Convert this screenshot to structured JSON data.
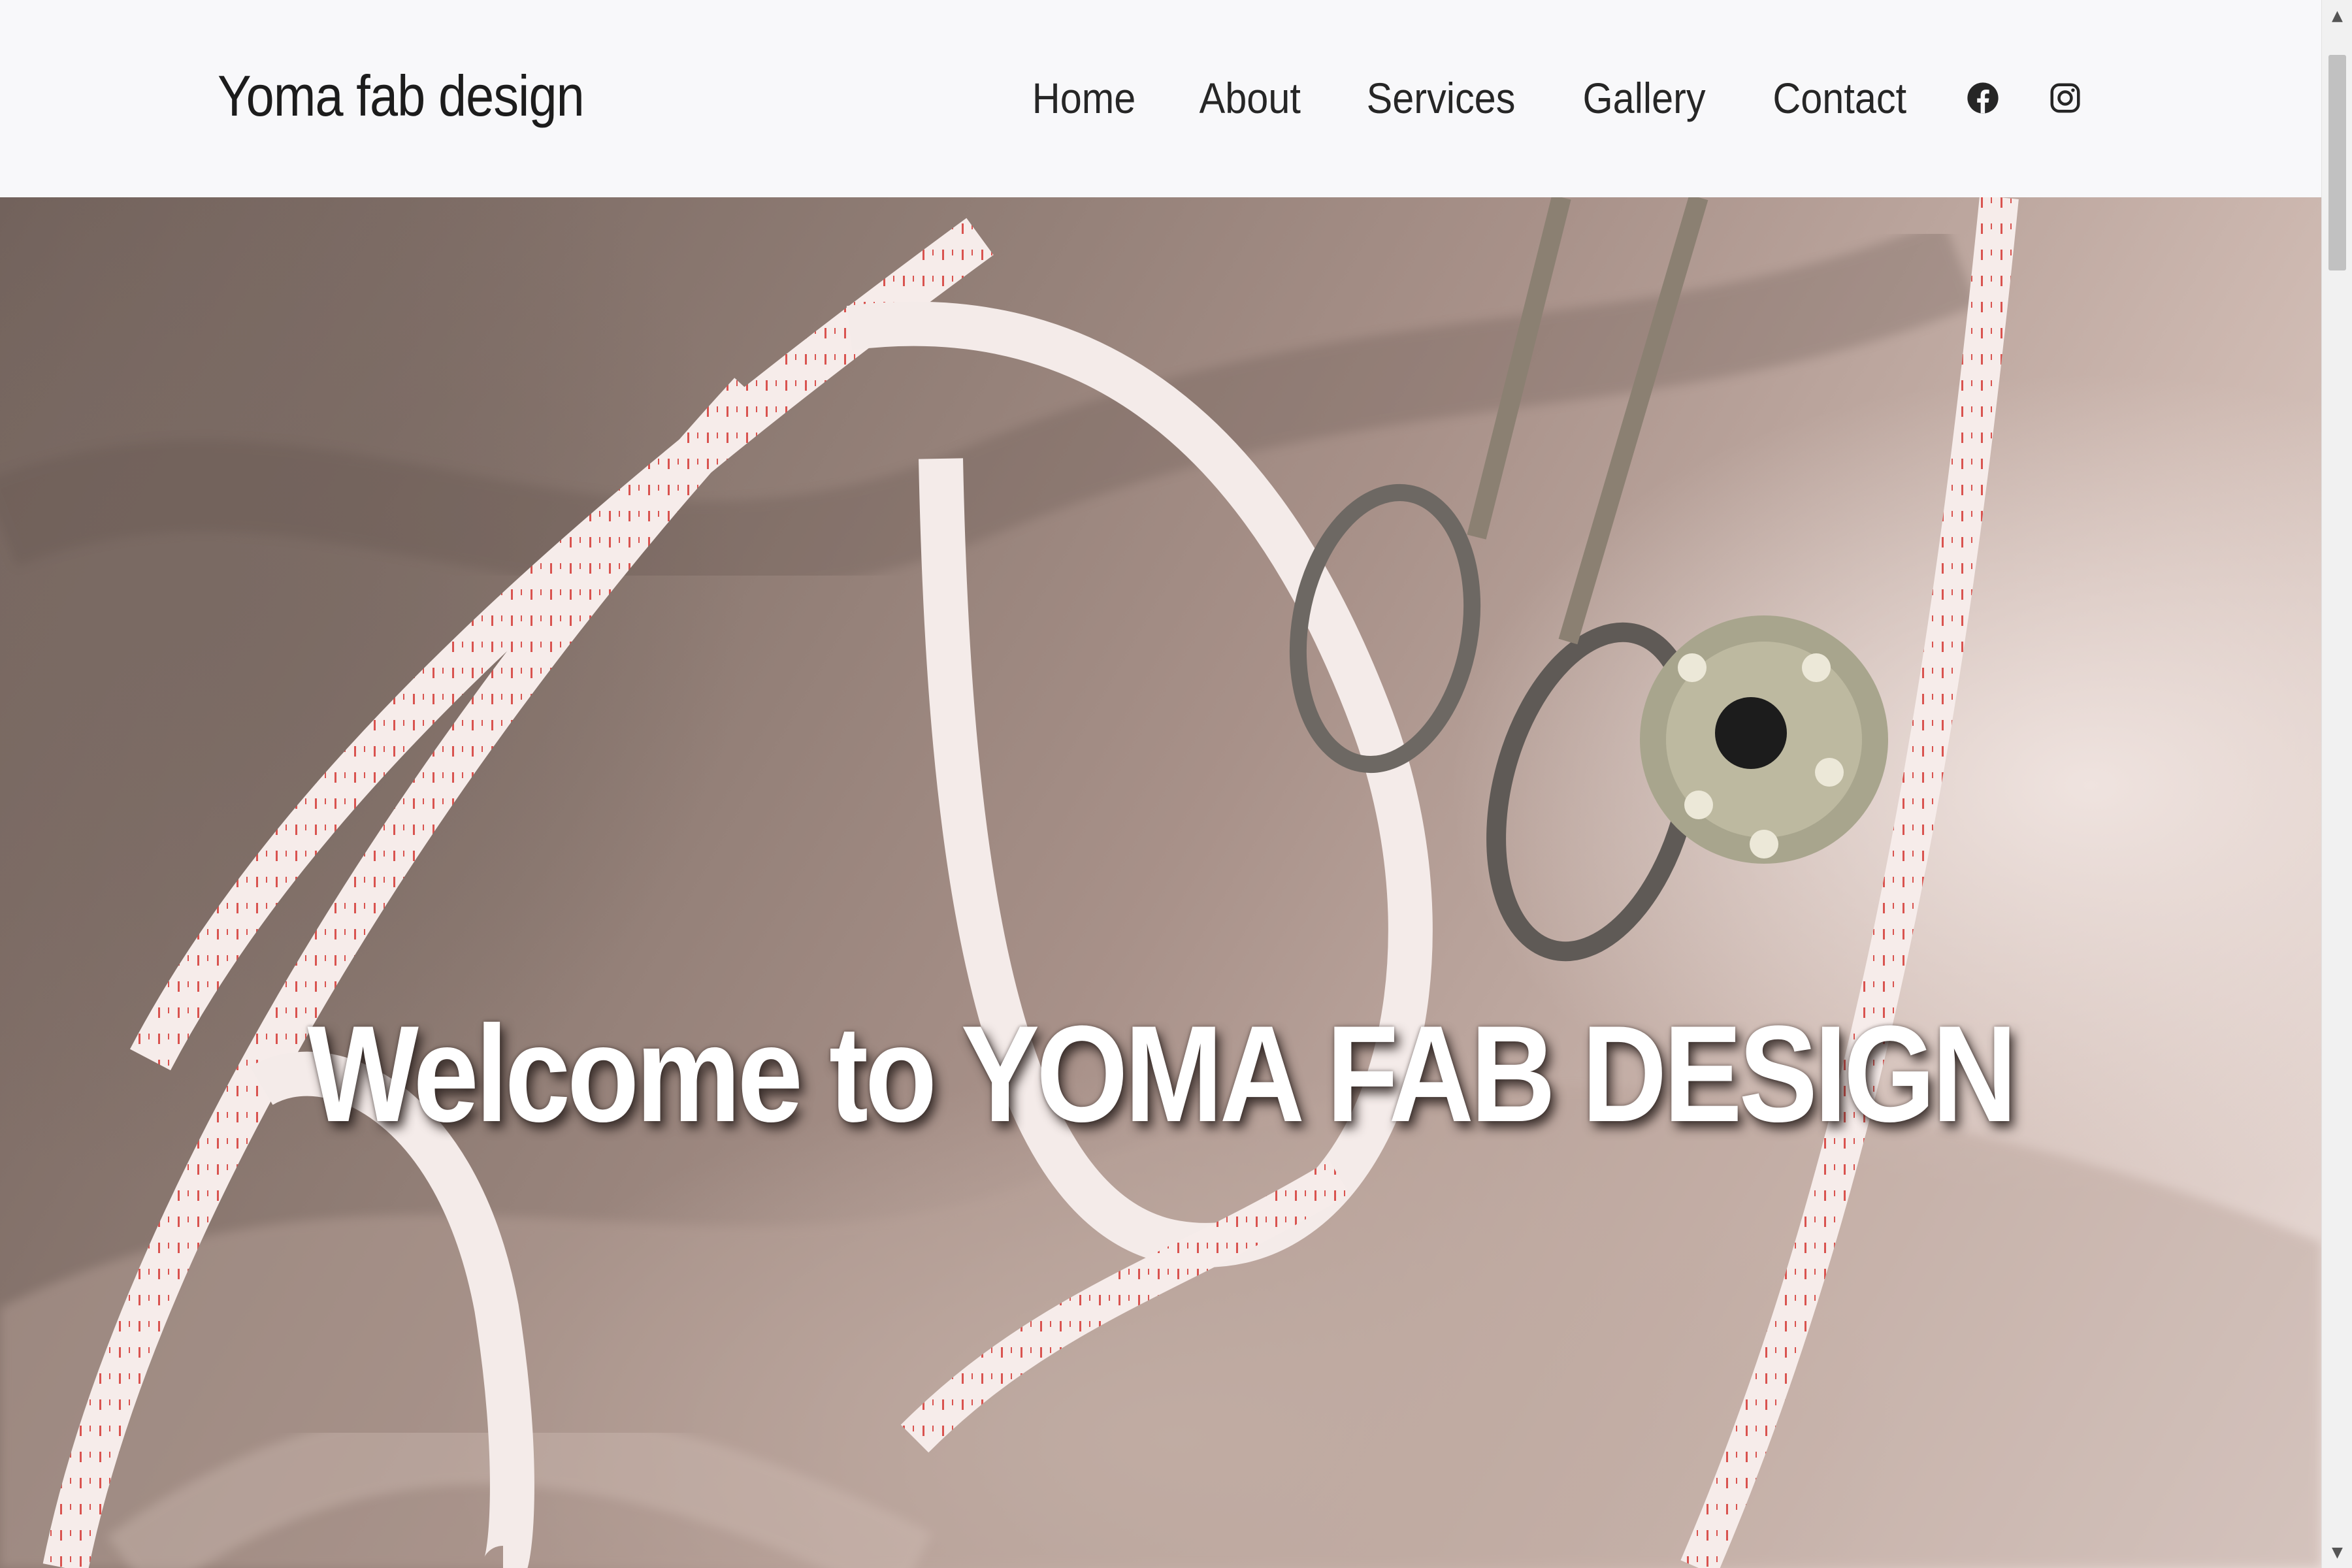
{
  "navbar": {
    "brand": "Yoma fab design",
    "links": [
      "Home",
      "About",
      "Services",
      "Gallery",
      "Contact"
    ],
    "social": [
      "facebook-icon",
      "instagram-icon"
    ]
  },
  "hero": {
    "title": "Welcome to YOMA FAB DESIGN",
    "image": "fabric with measuring tape, scissors and bobbin"
  },
  "colors": {
    "navbar_bg": "#f8f8fa",
    "nav_text": "#262626",
    "hero_text": "#ffffff"
  },
  "scrollbar": {
    "up_arrow": "▲",
    "down_arrow": "▼"
  }
}
